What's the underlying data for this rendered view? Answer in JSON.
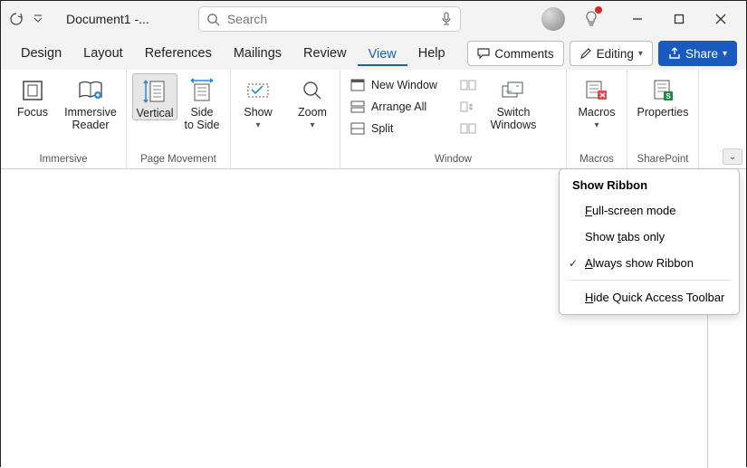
{
  "title": "Document1 -...",
  "search": {
    "placeholder": "Search"
  },
  "tabs": {
    "design": "Design",
    "layout": "Layout",
    "references": "References",
    "mailings": "Mailings",
    "review": "Review",
    "view": "View",
    "help": "Help"
  },
  "rightButtons": {
    "comments": "Comments",
    "editing": "Editing",
    "share": "Share"
  },
  "ribbon": {
    "immersive": {
      "label": "Immersive",
      "focus": "Focus",
      "reader": "Immersive\nReader"
    },
    "pageMovement": {
      "label": "Page Movement",
      "vertical": "Vertical",
      "side": "Side\nto Side"
    },
    "show": {
      "label": "Show"
    },
    "zoom": {
      "label": "Zoom"
    },
    "window": {
      "label": "Window",
      "new": "New Window",
      "arrange": "Arrange All",
      "split": "Split",
      "switch": "Switch\nWindows"
    },
    "macros": {
      "label": "Macros",
      "btn": "Macros"
    },
    "sharepoint": {
      "label": "SharePoint",
      "btn": "Properties"
    }
  },
  "menu": {
    "title": "Show Ribbon",
    "full": "ull-screen mode",
    "tabsOnly": "abs only",
    "tabsOnlyPrefix": "Show ",
    "always": "lways show Ribbon",
    "hide": "ide Quick Access Toolbar"
  }
}
